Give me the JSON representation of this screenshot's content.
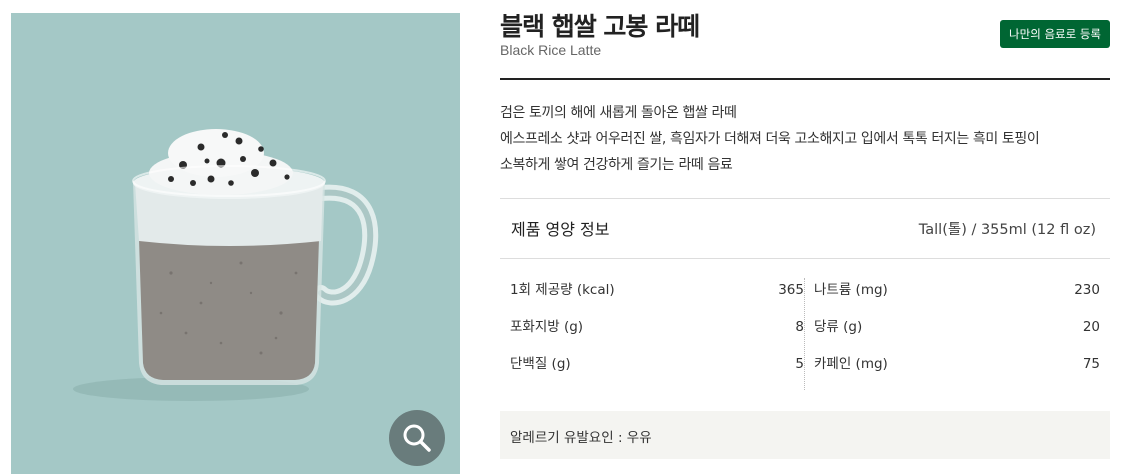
{
  "product": {
    "name_ko": "블랙 햅쌀 고봉 라떼",
    "name_en": "Black Rice Latte",
    "register_label": "나만의 음료로 등록",
    "description": [
      "검은 토끼의 해에 새롭게 돌아온 햅쌀 라떼",
      "에스프레소 샷과 어우러진 쌀, 흑임자가 더해져 더욱 고소해지고 입에서 톡톡 터지는 흑미 토핑이",
      "소복하게 쌓여 건강하게 즐기는 라떼 음료"
    ],
    "image_icon": "black-rice-latte-mug-illustration"
  },
  "zoom": {
    "icon": "magnifier-icon"
  },
  "nutrition": {
    "title": "제품 영양 정보",
    "serving_size": "Tall(톨) / 355ml (12 fl oz)",
    "left_rows": [
      {
        "label": "1회 제공량 (kcal)",
        "value": "365"
      },
      {
        "label": "포화지방 (g)",
        "value": "8"
      },
      {
        "label": "단백질 (g)",
        "value": "5"
      }
    ],
    "right_rows": [
      {
        "label": "나트륨 (mg)",
        "value": "230"
      },
      {
        "label": "당류 (g)",
        "value": "20"
      },
      {
        "label": "카페인 (mg)",
        "value": "75"
      }
    ]
  },
  "allergy": {
    "text": "알레르기 유발요인 : 우유"
  },
  "colors": {
    "brand_green": "#006633",
    "image_background": "#a4c8c6",
    "allergy_background": "#f4f4f1"
  }
}
